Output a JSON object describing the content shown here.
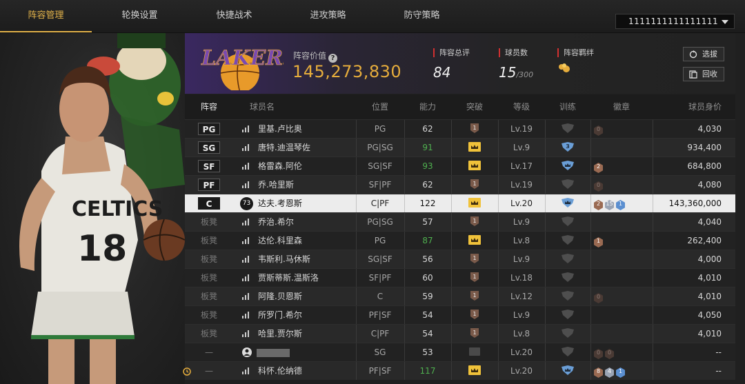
{
  "nav": {
    "tabs": [
      "阵容管理",
      "轮换设置",
      "快捷战术",
      "进攻策略",
      "防守策略"
    ],
    "active_tab": 0,
    "team_select_value": "1111111111111111"
  },
  "header": {
    "roster_value_label": "阵容价值",
    "roster_value": "145,273,830",
    "rating_label": "阵容总评",
    "rating_value": "84",
    "players_label": "球员数",
    "players_count": "15",
    "players_max": "/300",
    "bonds_label": "阵容羁绊",
    "select_button": "选拔",
    "recycle_button": "回收"
  },
  "table": {
    "headers": [
      "阵容",
      "球员名",
      "位置",
      "能力",
      "突破",
      "等级",
      "训练",
      "徽章",
      "球员身价"
    ],
    "rows": [
      {
        "slot": "PG",
        "name": "里基.卢比奥",
        "pos": "PG",
        "ovr": "62",
        "ovr_green": false,
        "breakthrough": "1",
        "level": "Lv.19",
        "training": "none",
        "badges": [
          {
            "v": "0",
            "c": "bronze-dark"
          }
        ],
        "value": "4,030",
        "bench": false
      },
      {
        "slot": "SG",
        "name": "唐特.迪温琴佐",
        "pos": "PG|SG",
        "ovr": "91",
        "ovr_green": true,
        "breakthrough": "crown",
        "level": "Lv.9",
        "training": "3",
        "badges": [],
        "value": "934,400",
        "bench": false
      },
      {
        "slot": "SF",
        "name": "格雷森.阿伦",
        "pos": "SG|SF",
        "ovr": "93",
        "ovr_green": true,
        "breakthrough": "crown",
        "level": "Lv.17",
        "training": "crown",
        "badges": [
          {
            "v": "2",
            "c": "bronze"
          }
        ],
        "value": "684,800",
        "bench": false
      },
      {
        "slot": "PF",
        "name": "乔.哈里斯",
        "pos": "SF|PF",
        "ovr": "62",
        "ovr_green": false,
        "breakthrough": "1",
        "level": "Lv.19",
        "training": "none",
        "badges": [
          {
            "v": "0",
            "c": "bronze-dark"
          }
        ],
        "value": "4,080",
        "bench": false
      },
      {
        "slot": "C",
        "name": "达夫.考恩斯",
        "ovr_icon": "73",
        "pos": "C|PF",
        "ovr": "122",
        "ovr_green": false,
        "breakthrough": "crown",
        "level": "Lv.20",
        "training": "crown",
        "badges": [
          {
            "v": "2",
            "c": "bronze"
          },
          {
            "v": "15",
            "c": "silver"
          },
          {
            "v": "1",
            "c": "blue"
          }
        ],
        "value": "143,360,000",
        "bench": false,
        "selected": true
      },
      {
        "slot": "板凳",
        "name": "乔治.希尔",
        "pos": "PG|SG",
        "ovr": "57",
        "ovr_green": false,
        "breakthrough": "1",
        "level": "Lv.9",
        "training": "none",
        "badges": [],
        "value": "4,040",
        "bench": true
      },
      {
        "slot": "板凳",
        "name": "达伦.科里森",
        "pos": "PG",
        "ovr": "87",
        "ovr_green": true,
        "breakthrough": "crown",
        "level": "Lv.8",
        "training": "none",
        "badges": [
          {
            "v": "1",
            "c": "bronze"
          }
        ],
        "value": "262,400",
        "bench": true
      },
      {
        "slot": "板凳",
        "name": "韦斯利.马休斯",
        "pos": "SG|SF",
        "ovr": "56",
        "ovr_green": false,
        "breakthrough": "1",
        "level": "Lv.9",
        "training": "none",
        "badges": [],
        "value": "4,000",
        "bench": true
      },
      {
        "slot": "板凳",
        "name": "贾斯蒂斯.温斯洛",
        "pos": "SF|PF",
        "ovr": "60",
        "ovr_green": false,
        "breakthrough": "1",
        "level": "Lv.18",
        "training": "none",
        "badges": [],
        "value": "4,010",
        "bench": true
      },
      {
        "slot": "板凳",
        "name": "阿隆.贝恩斯",
        "pos": "C",
        "ovr": "59",
        "ovr_green": false,
        "breakthrough": "1",
        "level": "Lv.12",
        "training": "none",
        "badges": [
          {
            "v": "0",
            "c": "bronze-dark"
          }
        ],
        "value": "4,010",
        "bench": true
      },
      {
        "slot": "板凳",
        "name": "所罗门.希尔",
        "pos": "PF|SF",
        "ovr": "54",
        "ovr_green": false,
        "breakthrough": "1",
        "level": "Lv.9",
        "training": "none",
        "badges": [],
        "value": "4,050",
        "bench": true
      },
      {
        "slot": "板凳",
        "name": "哈里.贾尔斯",
        "pos": "C|PF",
        "ovr": "54",
        "ovr_green": false,
        "breakthrough": "1",
        "level": "Lv.8",
        "training": "none",
        "badges": [],
        "value": "4,010",
        "bench": true
      },
      {
        "slot": "—",
        "name": "",
        "censored": true,
        "pos": "SG",
        "ovr": "53",
        "ovr_green": false,
        "breakthrough": "gray",
        "level": "Lv.20",
        "training": "none",
        "badges": [
          {
            "v": "0",
            "c": "bronze-dark"
          },
          {
            "v": "0",
            "c": "bronze-dark"
          }
        ],
        "value": "--",
        "bench": true
      },
      {
        "slot": "—",
        "name": "科怀.伦纳德",
        "alarm": true,
        "pos": "PF|SF",
        "ovr": "117",
        "ovr_green": true,
        "breakthrough": "crown",
        "level": "Lv.20",
        "training": "crown",
        "badges": [
          {
            "v": "8",
            "c": "bronze"
          },
          {
            "v": "4",
            "c": "silver"
          },
          {
            "v": "1",
            "c": "blue"
          }
        ],
        "value": "--",
        "bench": true
      }
    ]
  },
  "colors": {
    "accent": "#e2b24a",
    "value_gold": "#e6ad3c",
    "green": "#4fb04f",
    "lakers_purple": "#552583",
    "lakers_gold": "#fdb927"
  },
  "icons": {
    "dropdown": "chevron-down-icon",
    "help": "help-icon",
    "select": "refresh-icon",
    "recycle": "recycle-icon",
    "bond": "bond-icon",
    "signal": "signal-icon",
    "crown": "crown-icon",
    "shield": "shield-icon"
  },
  "left_art": {
    "jersey_text": "CELTICS",
    "jersey_number": "18"
  },
  "logo_text": "LAKERS"
}
